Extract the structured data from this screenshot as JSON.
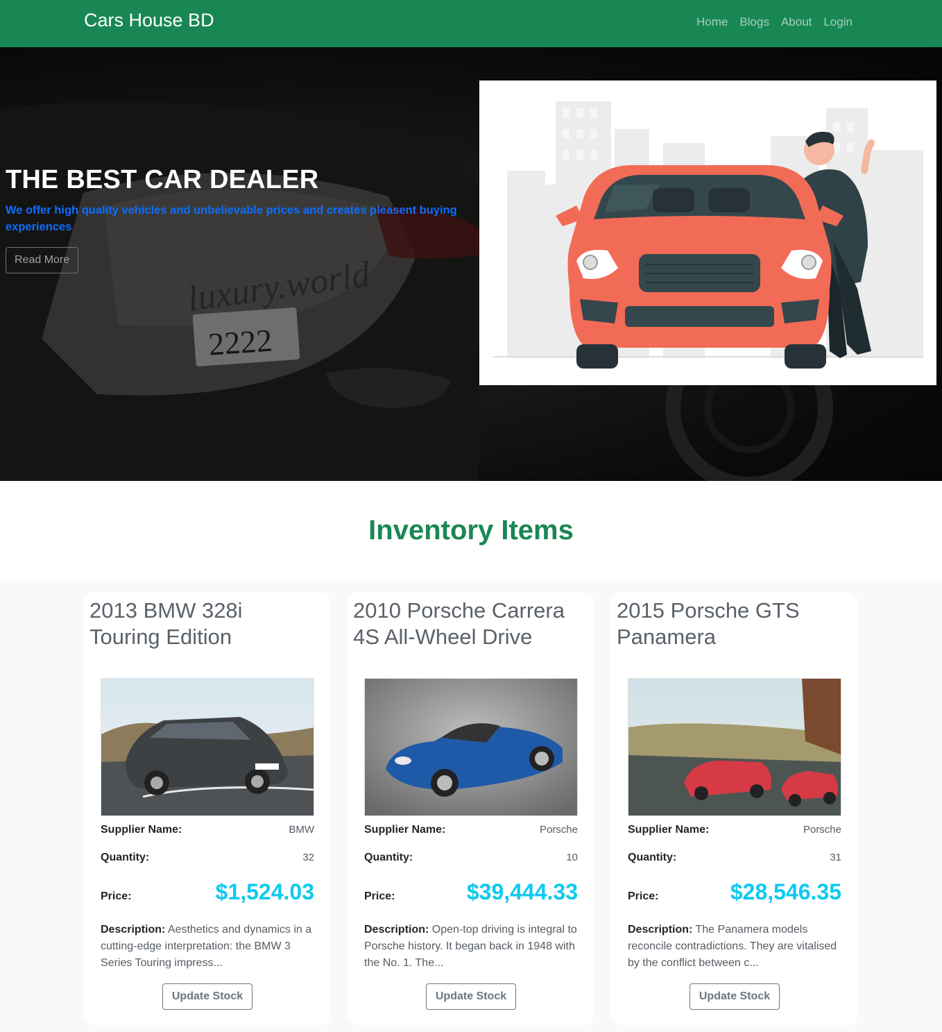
{
  "nav": {
    "brand": "Cars House BD",
    "links": [
      "Home",
      "Blogs",
      "About",
      "Login"
    ]
  },
  "hero": {
    "title": "THE BEST CAR DEALER",
    "subtitle": "We offer high quality vehicles and unbelievable prices and creates pleasent buying experiences",
    "button": "Read More",
    "bg_plate_text": "2222",
    "bg_script_text": "luxury.world"
  },
  "inventory": {
    "title": "Inventory Items",
    "labels": {
      "supplier": "Supplier Name:",
      "quantity": "Quantity:",
      "price": "Price:",
      "description": "Description:",
      "button": "Update Stock"
    },
    "items": [
      {
        "name": "2013 BMW 328i Touring Edition",
        "supplier": "BMW",
        "quantity": "32",
        "price": "$1,524.03",
        "description": "Aesthetics and dynamics in a cutting-edge interpretation: the BMW 3 Series Touring impress...",
        "image": "dark-grey-bmw-wagon"
      },
      {
        "name": "2010 Porsche Carrera 4S All-Wheel Drive",
        "supplier": "Porsche",
        "quantity": "10",
        "price": "$39,444.33",
        "description": "Open-top driving is integral to Porsche history. It began back in 1948 with the No. 1. The...",
        "image": "blue-porsche-convertible"
      },
      {
        "name": "2015 Porsche GTS Panamera",
        "supplier": "Porsche",
        "quantity": "31",
        "price": "$28,546.35",
        "description": "The Panamera models reconcile contradictions. They are vitalised by the conflict between c...",
        "image": "red-porsche-panamera-pair"
      }
    ]
  },
  "colors": {
    "navbar": "#198754",
    "accent_blue": "#0d6efd",
    "price_cyan": "#0dcaf0",
    "illustration_car": "#f26b56"
  }
}
